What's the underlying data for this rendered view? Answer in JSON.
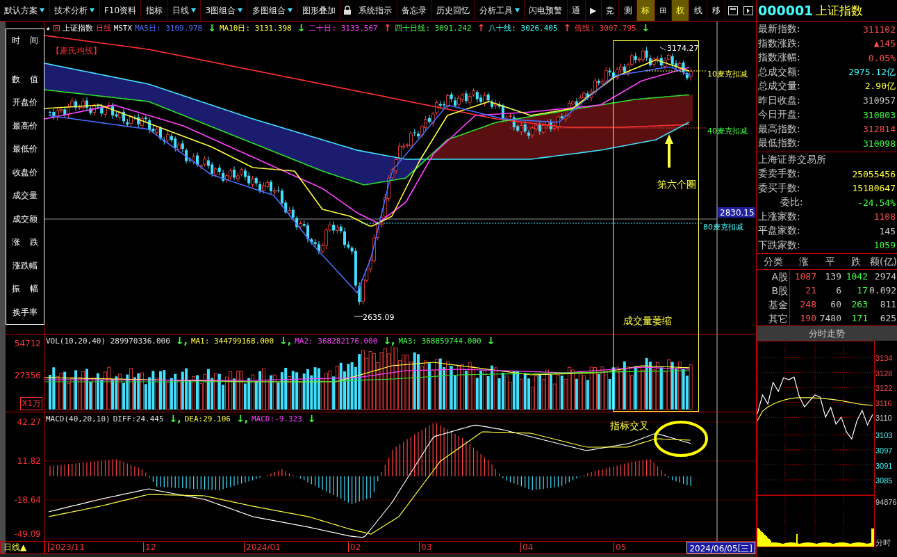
{
  "toolbar": {
    "items": [
      {
        "kind": "button",
        "label": "默认方案",
        "dropdown": true,
        "selected": false
      },
      {
        "kind": "button",
        "label": "技术分析",
        "dropdown": true,
        "selected": false
      },
      {
        "kind": "button",
        "label": "F10资料",
        "dropdown": false,
        "selected": false
      },
      {
        "kind": "button",
        "label": "指标",
        "dropdown": false,
        "selected": false
      },
      {
        "kind": "button",
        "label": "日线",
        "dropdown": true,
        "selected": false
      },
      {
        "kind": "button",
        "label": "3图组合",
        "dropdown": true,
        "selected": false
      },
      {
        "kind": "button",
        "label": "多图组合",
        "dropdown": true,
        "selected": false
      },
      {
        "kind": "button",
        "label": "图形叠加",
        "dropdown": false,
        "selected": false
      },
      {
        "kind": "lock"
      },
      {
        "kind": "button",
        "label": "系统指示",
        "dropdown": false,
        "selected": false
      },
      {
        "kind": "button",
        "label": "备忘录",
        "dropdown": false,
        "selected": false
      },
      {
        "kind": "button",
        "label": "历史回忆",
        "dropdown": false,
        "selected": false
      },
      {
        "kind": "button",
        "label": "分析工具",
        "dropdown": true,
        "selected": false
      },
      {
        "kind": "button",
        "label": "闪电预警",
        "dropdown": false,
        "selected": false
      },
      {
        "kind": "button",
        "label": "通",
        "dropdown": false,
        "selected": false
      },
      {
        "kind": "button",
        "label": "▶",
        "dropdown": false,
        "selected": false
      },
      {
        "kind": "button",
        "label": "竞",
        "dropdown": false,
        "selected": false
      },
      {
        "kind": "button",
        "label": "测",
        "dropdown": false,
        "selected": false
      },
      {
        "kind": "button",
        "label": "标",
        "dropdown": false,
        "selected": true
      },
      {
        "kind": "button",
        "label": "⊞",
        "dropdown": false,
        "selected": false
      },
      {
        "kind": "button",
        "label": "权",
        "dropdown": false,
        "selected": true
      },
      {
        "kind": "button",
        "label": "线",
        "dropdown": false,
        "selected": false
      },
      {
        "kind": "button",
        "label": "移",
        "dropdown": false,
        "selected": false
      },
      {
        "kind": "window"
      },
      {
        "kind": "panel"
      }
    ]
  },
  "info_panel": {
    "labels": [
      "时 间",
      "数 值",
      "开盘价",
      "最高价",
      "最低价",
      "收盘价",
      "成交量",
      "成交额",
      "涨 跌",
      "涨跌幅",
      "振 幅",
      "换手率"
    ]
  },
  "price_chart": {
    "favorite_mark": "★",
    "name": "上证指数",
    "period": "日线",
    "indicator": "MSTX",
    "legend": [
      {
        "label": "MA5日:",
        "value": "3109.978",
        "arrow": {
          "text": "↓",
          "color": "#40ff40"
        },
        "color": "#4a6cff"
      },
      {
        "label": "MA10日:",
        "value": "3131.398",
        "arrow": {
          "text": "↓",
          "color": "#40ff40"
        },
        "color": "#ffff40"
      },
      {
        "label": "二十日:",
        "value": "3133.567",
        "arrow": {
          "text": "↑",
          "color": "#ff4040"
        },
        "color": "#ff40ff"
      },
      {
        "label": "四十日线:",
        "value": "3091.242",
        "arrow": {
          "text": "↑",
          "color": "#ff4040"
        },
        "color": "#40ff40"
      },
      {
        "label": "八十线:",
        "value": "3026.405",
        "arrow": {
          "text": "↑",
          "color": "#ff4040"
        },
        "color": "#40ffff"
      },
      {
        "label": "倍线:",
        "value": "3007.795",
        "arrow": {
          "text": "↓",
          "color": "#40ff40"
        },
        "color": "#ff4040"
      }
    ],
    "ma_label": "【麦氏均线】",
    "high_label": "3174.27",
    "low_label": "2635.09",
    "price_tag": "2830.15",
    "markers": [
      {
        "label": "10麦克扣减",
        "color": "#ffff40"
      },
      {
        "label": "40麦克扣减",
        "color": "#40ff40"
      },
      {
        "label": "80麦克扣减",
        "color": "#40ffff"
      }
    ],
    "notes": [
      "第六个圈",
      "成交量萎缩"
    ]
  },
  "volume_chart": {
    "legend": [
      {
        "label": "VOL(10,20,40)",
        "value": "289970336.000",
        "arrow": {
          "text": "↓,",
          "color": "#40ff40"
        },
        "color": "#e0e0e0"
      },
      {
        "label": "MA1:",
        "value": "344799168.000",
        "arrow": {
          "text": "↓,",
          "color": "#40ff40"
        },
        "color": "#ffff40"
      },
      {
        "label": "MA2:",
        "value": "368282176.000",
        "arrow": {
          "text": "↓,",
          "color": "#40ff40"
        },
        "color": "#ff40ff"
      },
      {
        "label": "MA3:",
        "value": "368859744.000",
        "arrow": {
          "text": "↓",
          "color": "#40ff40"
        },
        "color": "#40ff40"
      }
    ],
    "y_ticks": [
      "54712",
      "27356"
    ],
    "unit": "X1万"
  },
  "macd_chart": {
    "legend": [
      {
        "label": "MACD(40,20,10)",
        "color": "#e0e0e0"
      },
      {
        "label": "DIFF:",
        "value": "24.445",
        "arrow": {
          "text": "↓,",
          "color": "#40ff40"
        },
        "color": "#e0e0e0"
      },
      {
        "label": "DEA:",
        "value": "29.106",
        "arrow": {
          "text": "↓,",
          "color": "#40ff40"
        },
        "color": "#ffff40"
      },
      {
        "label": "MACD:",
        "value": "-9.323",
        "arrow": {
          "text": "↓",
          "color": "#40ff40"
        },
        "color": "#ff40ff"
      }
    ],
    "y_ticks": [
      "42.27",
      "11.82",
      "-18.64",
      "-49.09"
    ],
    "note": "指标交叉"
  },
  "time_axis": {
    "period": "日线▲",
    "labels": [
      "2023/11",
      "12",
      "2024/01",
      "02",
      "03",
      "04",
      "05"
    ],
    "current_date": "2024/06/05[三]"
  },
  "quote": {
    "code": "000001",
    "name": "上证指数",
    "rows": [
      {
        "label": "最新指数:",
        "value": "311102",
        "color": "#ff5050"
      },
      {
        "label": "指数涨跌:",
        "value": "▲145",
        "color": "#ff5050"
      },
      {
        "label": "指数涨幅:",
        "value": "0.05%",
        "color": "#ff5050"
      },
      {
        "label": "总成交额:",
        "value": "2975.12亿",
        "color": "#40ffff"
      },
      {
        "label": "总成交量:",
        "value": "2.90亿",
        "color": "#ffff40"
      },
      {
        "label": "昨日收盘:",
        "value": "310957",
        "color": "#c8c8c8"
      },
      {
        "label": "今日开盘:",
        "value": "310803",
        "color": "#40ff40"
      },
      {
        "label": "最高指数:",
        "value": "312814",
        "color": "#ff5050"
      },
      {
        "label": "最低指数:",
        "value": "310098",
        "color": "#40ff40"
      }
    ],
    "exchange": "上海证券交易所",
    "exchange_rows": [
      {
        "label": "委卖手数:",
        "value": "25055456",
        "color": "#ffff40"
      },
      {
        "label": "委买手数:",
        "value": "15180647",
        "color": "#ffff40"
      },
      {
        "label": "委比:",
        "value": "-24.54%",
        "color": "#40ff40"
      },
      {
        "label": "上涨家数:",
        "value": "1108",
        "color": "#ff5050"
      },
      {
        "label": "平盘家数:",
        "value": "145",
        "color": "#c8c8c8"
      },
      {
        "label": "下跌家数:",
        "value": "1059",
        "color": "#40ff40"
      }
    ]
  },
  "breadth_table": {
    "columns": [
      "分类",
      "涨",
      "平",
      "跌",
      "额(亿)"
    ],
    "rows": [
      [
        "A股",
        "1087",
        "139",
        "1042",
        "2974"
      ],
      [
        "B股",
        "21",
        "6",
        "17",
        "0.092"
      ],
      [
        "基金",
        "248",
        "60",
        "263",
        "811"
      ],
      [
        "其它",
        "190",
        "7480",
        "171",
        "625"
      ]
    ]
  },
  "intraday": {
    "title": "分时走势",
    "chart_data": {
      "type": "line",
      "yticks": [
        3134,
        3128,
        3122,
        3116,
        3110,
        3103,
        3097,
        3091,
        3085
      ],
      "ylim": [
        3078.9,
        3140.7
      ],
      "grid": true,
      "series": [
        {
          "color": "#ffffff",
          "values": [
            3111.5,
            3119.0,
            3115.4,
            3124.0,
            3120.4,
            3125.9,
            3125.1,
            3126.2,
            3118.4,
            3114.2,
            3116.7,
            3119.0,
            3118.1,
            3110.1,
            3114.0,
            3107.3,
            3110.1,
            3104.2,
            3101.4,
            3108.7,
            3112.8,
            3107.0,
            3111.2
          ]
        },
        {
          "color": "#ffff40",
          "values": [
            3108.7,
            3112.5,
            3114.2,
            3115.3,
            3116.2,
            3116.9,
            3117.4,
            3117.8,
            3117.9,
            3117.9,
            3117.9,
            3117.8,
            3117.7,
            3117.5,
            3117.3,
            3117.0,
            3116.7,
            3116.3,
            3115.9,
            3115.5,
            3115.2,
            3115.0,
            3114.8
          ]
        }
      ]
    },
    "volume_tick": "94876",
    "volume_label": "分时"
  }
}
